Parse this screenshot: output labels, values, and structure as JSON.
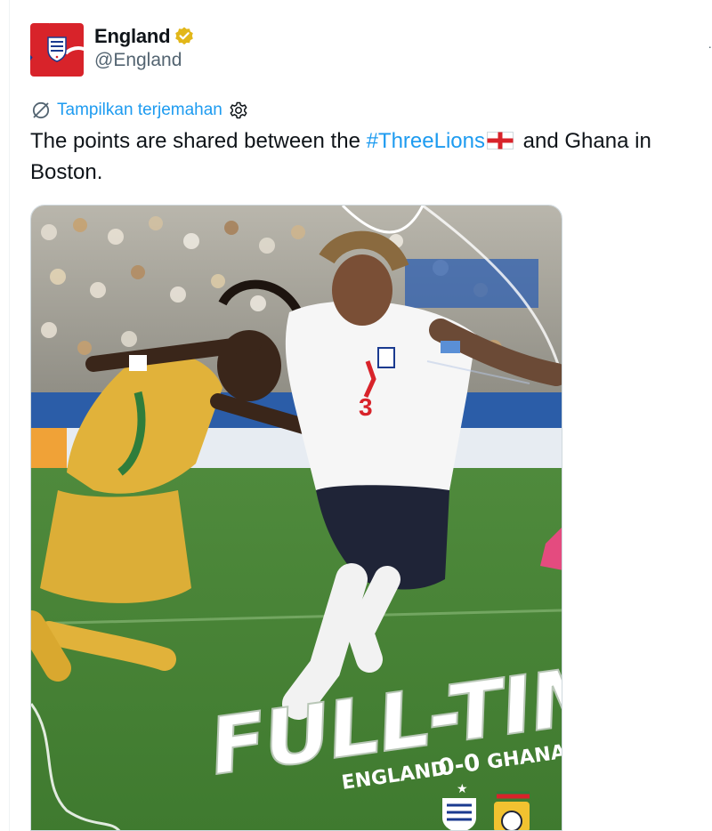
{
  "account": {
    "display_name": "England",
    "handle": "@England",
    "verified_icon": "gold-verified-badge-icon",
    "avatar_icon": "england-crest-avatar"
  },
  "tweet": {
    "translate_label": "Tampilkan terjemahan",
    "text_before": "The points are shared between the ",
    "hashtag": "#ThreeLions",
    "flag_icon": "england-flag-icon",
    "text_after": " and Ghana in Boston."
  },
  "media": {
    "headline": "FULL-TIME",
    "score_home": "ENGLAND",
    "score": "0-0",
    "score_away": "GHANA",
    "home_crest_icon": "england-crest-icon",
    "away_crest_icon": "ghana-crest-icon",
    "player_number": "3"
  },
  "colors": {
    "link": "#1d9bf0",
    "muted": "#536471",
    "text": "#0f1419",
    "verified_gold": "#e2b719",
    "brand_red": "#d8232a"
  }
}
